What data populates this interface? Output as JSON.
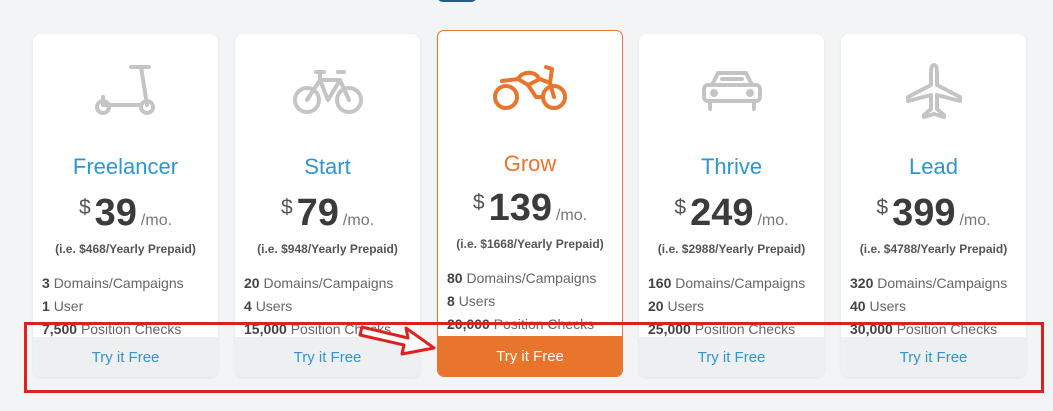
{
  "colors": {
    "accent_blue": "#2f95d2",
    "accent_orange": "#e9742c",
    "highlight_red": "#e02020"
  },
  "plans": [
    {
      "icon": "scooter-icon",
      "name": "Freelancer",
      "currency": "$",
      "price": "39",
      "period": "/mo.",
      "yearly": "(i.e. $468/Yearly Prepaid)",
      "features": [
        {
          "value": "3",
          "label": "Domains/Campaigns"
        },
        {
          "value": "1",
          "label": "User"
        },
        {
          "value": "7,500",
          "label": "Position Checks"
        }
      ],
      "cta": "Try it Free"
    },
    {
      "icon": "bicycle-icon",
      "name": "Start",
      "currency": "$",
      "price": "79",
      "period": "/mo.",
      "yearly": "(i.e. $948/Yearly Prepaid)",
      "features": [
        {
          "value": "20",
          "label": "Domains/Campaigns"
        },
        {
          "value": "4",
          "label": "Users"
        },
        {
          "value": "15,000",
          "label": "Position Checks"
        }
      ],
      "cta": "Try it Free"
    },
    {
      "icon": "motorcycle-icon",
      "name": "Grow",
      "currency": "$",
      "price": "139",
      "period": "/mo.",
      "yearly": "(i.e. $1668/Yearly Prepaid)",
      "features": [
        {
          "value": "80",
          "label": "Domains/Campaigns"
        },
        {
          "value": "8",
          "label": "Users"
        },
        {
          "value": "20,000",
          "label": "Position Checks"
        }
      ],
      "cta": "Try it Free"
    },
    {
      "icon": "car-icon",
      "name": "Thrive",
      "currency": "$",
      "price": "249",
      "period": "/mo.",
      "yearly": "(i.e. $2988/Yearly Prepaid)",
      "features": [
        {
          "value": "160",
          "label": "Domains/Campaigns"
        },
        {
          "value": "20",
          "label": "Users"
        },
        {
          "value": "25,000",
          "label": "Position Checks"
        }
      ],
      "cta": "Try it Free"
    },
    {
      "icon": "airplane-icon",
      "name": "Lead",
      "currency": "$",
      "price": "399",
      "period": "/mo.",
      "yearly": "(i.e. $4788/Yearly Prepaid)",
      "features": [
        {
          "value": "320",
          "label": "Domains/Campaigns"
        },
        {
          "value": "40",
          "label": "Users"
        },
        {
          "value": "30,000",
          "label": "Position Checks"
        }
      ],
      "cta": "Try it Free"
    }
  ]
}
